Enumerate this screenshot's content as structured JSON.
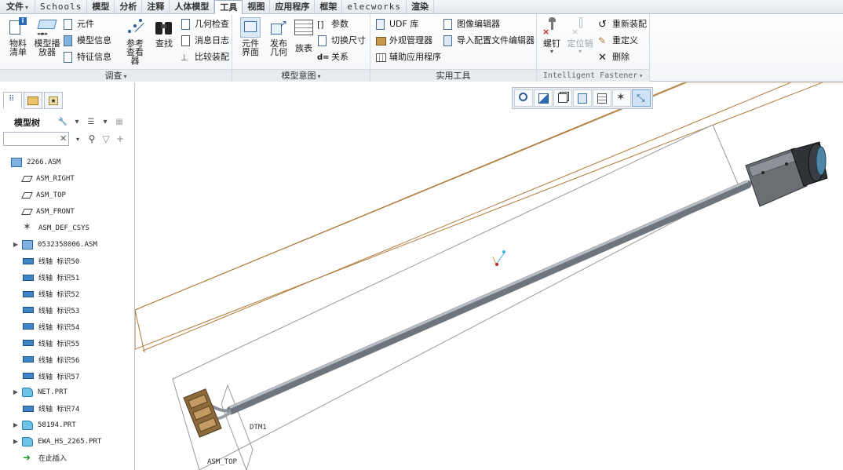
{
  "menu": {
    "tabs": [
      "文件",
      "Schools",
      "模型",
      "分析",
      "注释",
      "人体模型",
      "工具",
      "视图",
      "应用程序",
      "框架",
      "elecworks",
      "渲染"
    ],
    "active_tab": "工具"
  },
  "ribbon": {
    "groups": {
      "investigate": {
        "label": "调查",
        "big_buttons": [
          "物料清单",
          "模型播放器",
          "参考查看器",
          "查找"
        ],
        "small_buttons": [
          "元件",
          "模型信息",
          "特征信息",
          "几何检查",
          "消息日志",
          "比较装配"
        ]
      },
      "model_intent": {
        "label": "模型意图",
        "big_buttons": [
          "元件界面",
          "发布几何",
          "族表"
        ],
        "small_buttons": [
          "参数",
          "切换尺寸",
          "关系"
        ]
      },
      "utilities": {
        "label": "实用工具",
        "small_buttons": [
          "UDF 库",
          "外观管理器",
          "辅助应用程序",
          "图像编辑器",
          "导入配置文件编辑器"
        ]
      },
      "fastener": {
        "label": "Intelligent Fastener",
        "big_buttons": [
          "螺钉",
          "定位销"
        ],
        "small_buttons": [
          "重新装配",
          "重定义",
          "删除"
        ]
      }
    }
  },
  "model_tree": {
    "title": "模型树",
    "search_value": "",
    "nodes": [
      {
        "text": "2266.ASM",
        "icon": "assembly-icon",
        "expandable": false
      },
      {
        "text": "ASM_RIGHT",
        "icon": "datum-plane-icon",
        "expandable": false
      },
      {
        "text": "ASM_TOP",
        "icon": "datum-plane-icon",
        "expandable": false
      },
      {
        "text": "ASM_FRONT",
        "icon": "datum-plane-icon",
        "expandable": false
      },
      {
        "text": "ASM_DEF_CSYS",
        "icon": "csys-icon",
        "expandable": false
      },
      {
        "text": "0532358006.ASM",
        "icon": "assembly-icon",
        "expandable": true
      },
      {
        "text": "线轴 标识50",
        "icon": "spool-icon",
        "expandable": false
      },
      {
        "text": "线轴 标识51",
        "icon": "spool-icon",
        "expandable": false
      },
      {
        "text": "线轴 标识52",
        "icon": "spool-icon",
        "expandable": false
      },
      {
        "text": "线轴 标识53",
        "icon": "spool-icon",
        "expandable": false
      },
      {
        "text": "线轴 标识54",
        "icon": "spool-icon",
        "expandable": false
      },
      {
        "text": "线轴 标识55",
        "icon": "spool-icon",
        "expandable": false
      },
      {
        "text": "线轴 标识56",
        "icon": "spool-icon",
        "expandable": false
      },
      {
        "text": "线轴 标识57",
        "icon": "spool-icon",
        "expandable": false
      },
      {
        "text": "NET.PRT",
        "icon": "part-icon",
        "expandable": true
      },
      {
        "text": "线轴 标识74",
        "icon": "spool-icon",
        "expandable": false
      },
      {
        "text": "58194.PRT",
        "icon": "part-icon",
        "expandable": true
      },
      {
        "text": "EWA_HS_2265.PRT",
        "icon": "part-icon",
        "expandable": true
      },
      {
        "text": "在此插入",
        "icon": "insert-here-icon",
        "expandable": false
      }
    ]
  },
  "graphics": {
    "labels": {
      "dtm": "DTM1",
      "plane": "ASM_TOP"
    },
    "colors": {
      "cable": "#8a9099",
      "datum_line": "#b07a3a",
      "selection_box": "#9a9a9a",
      "connector": "#6b6e73"
    }
  }
}
